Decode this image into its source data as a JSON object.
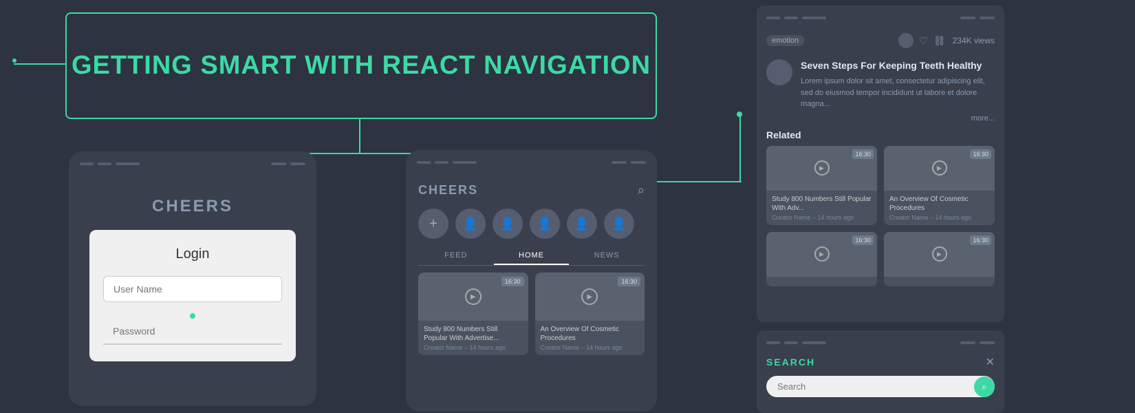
{
  "page": {
    "background_color": "#2d3340",
    "title": "Getting Smart With React Navigation"
  },
  "title_box": {
    "text": "GETTING SMART WITH REACT NAVIGATION",
    "border_color": "#3dd9a4",
    "text_color": "#3dd9a4"
  },
  "left_phone": {
    "app_name": "CHEERS",
    "login_box": {
      "title": "Login",
      "username_placeholder": "User Name",
      "password_placeholder": "Password"
    }
  },
  "center_phone": {
    "app_name": "CHEERS",
    "search_icon": "🔍",
    "tabs": [
      "FEED",
      "HOME",
      "NEWS"
    ],
    "active_tab": "HOME",
    "card1": {
      "title": "Study 800 Numbers Still Popular With Advertise...",
      "meta": "Creator Name – 14 hours ago",
      "duration": "16:30"
    },
    "card2": {
      "title": "An Overview Of Cosmetic Procedures",
      "meta": "Creator Name – 14 hours ago",
      "duration": "16:30"
    }
  },
  "right_panel": {
    "emotion_tag": "emotion",
    "views": "234K views",
    "article_title": "Seven Steps For Keeping Teeth Healthy",
    "article_desc": "Lorem ipsum dolor sit amet, consectetur adipiscing elit, sed do eiusmod tempor incididunt ut labore et dolore magna...",
    "more_label": "more...",
    "related_label": "Related",
    "related_items": [
      {
        "title": "Study 800 Numbers Still Popular With Adv...",
        "meta": "Creator Name – 14 hours ago",
        "duration": "16:30"
      },
      {
        "title": "An Overview Of Cosmetic Procedures",
        "meta": "Creator Name – 14 hours ago",
        "duration": "16:30"
      },
      {
        "title": "",
        "meta": "",
        "duration": "16:30"
      },
      {
        "title": "",
        "meta": "",
        "duration": "16:30"
      }
    ]
  },
  "search_panel": {
    "label": "SEARCH",
    "placeholder": "Search",
    "close_icon": "✕"
  }
}
